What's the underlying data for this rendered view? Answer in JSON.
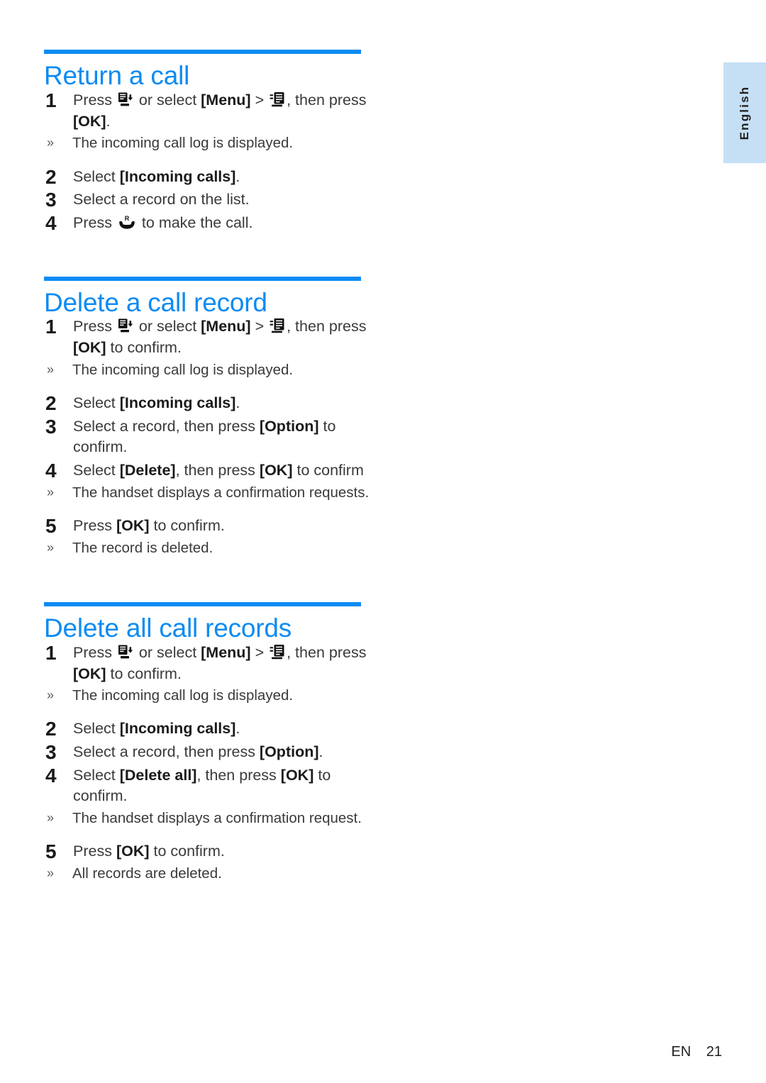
{
  "language_tab": {
    "label": "English"
  },
  "footer": {
    "locale": "EN",
    "page": "21"
  },
  "colors": {
    "accent": "#0d8bf2",
    "tab_background": "#c5e0f5",
    "body_text": "#3a3a3c"
  },
  "icons": {
    "call_log_key": "call-log-key-icon",
    "call_log_menu": "call-log-menu-icon",
    "talk_key": "talk-key-icon"
  },
  "sections": [
    {
      "id": "return-a-call",
      "heading": "Return a call",
      "steps": [
        {
          "number": "1",
          "parts": [
            {
              "t": "Press "
            },
            {
              "icon": "call_log_key"
            },
            {
              "t": " or select "
            },
            {
              "t": "[Menu]",
              "b": true
            },
            {
              "t": " > "
            },
            {
              "icon": "call_log_menu"
            },
            {
              "t": ", then press "
            },
            {
              "t": "[OK]",
              "b": true
            },
            {
              "t": "."
            }
          ],
          "note": "The incoming call log is displayed."
        },
        {
          "number": "2",
          "parts": [
            {
              "t": "Select "
            },
            {
              "t": "[Incoming calls]",
              "b": true
            },
            {
              "t": "."
            }
          ]
        },
        {
          "number": "3",
          "parts": [
            {
              "t": "Select a record on the list."
            }
          ]
        },
        {
          "number": "4",
          "parts": [
            {
              "t": "Press "
            },
            {
              "icon": "talk_key"
            },
            {
              "t": " to make the call."
            }
          ]
        }
      ]
    },
    {
      "id": "delete-a-call-record",
      "heading": "Delete a call record",
      "steps": [
        {
          "number": "1",
          "parts": [
            {
              "t": "Press "
            },
            {
              "icon": "call_log_key"
            },
            {
              "t": " or select "
            },
            {
              "t": "[Menu]",
              "b": true
            },
            {
              "t": " > "
            },
            {
              "icon": "call_log_menu"
            },
            {
              "t": ", then press "
            },
            {
              "t": "[OK]",
              "b": true
            },
            {
              "t": " to confirm."
            }
          ],
          "note": "The incoming call log is displayed."
        },
        {
          "number": "2",
          "parts": [
            {
              "t": "Select "
            },
            {
              "t": "[Incoming calls]",
              "b": true
            },
            {
              "t": "."
            }
          ]
        },
        {
          "number": "3",
          "parts": [
            {
              "t": "Select a record, then press "
            },
            {
              "t": "[Option]",
              "b": true
            },
            {
              "t": " to confirm."
            }
          ]
        },
        {
          "number": "4",
          "parts": [
            {
              "t": "Select "
            },
            {
              "t": "[Delete]",
              "b": true
            },
            {
              "t": ", then press "
            },
            {
              "t": "[OK]",
              "b": true
            },
            {
              "t": " to confirm"
            }
          ],
          "note": "The handset displays a confirmation requests."
        },
        {
          "number": "5",
          "parts": [
            {
              "t": "Press "
            },
            {
              "t": "[OK]",
              "b": true
            },
            {
              "t": " to confirm."
            }
          ],
          "note": "The record is deleted."
        }
      ]
    },
    {
      "id": "delete-all-call-records",
      "heading": "Delete all call records",
      "steps": [
        {
          "number": "1",
          "parts": [
            {
              "t": "Press "
            },
            {
              "icon": "call_log_key"
            },
            {
              "t": " or select "
            },
            {
              "t": "[Menu]",
              "b": true
            },
            {
              "t": " > "
            },
            {
              "icon": "call_log_menu"
            },
            {
              "t": ", then press "
            },
            {
              "t": "[OK]",
              "b": true
            },
            {
              "t": " to confirm."
            }
          ],
          "note": "The incoming call log is displayed."
        },
        {
          "number": "2",
          "parts": [
            {
              "t": "Select "
            },
            {
              "t": "[Incoming calls]",
              "b": true
            },
            {
              "t": "."
            }
          ]
        },
        {
          "number": "3",
          "parts": [
            {
              "t": "Select a record, then press "
            },
            {
              "t": "[Option]",
              "b": true
            },
            {
              "t": "."
            }
          ]
        },
        {
          "number": "4",
          "parts": [
            {
              "t": "Select "
            },
            {
              "t": "[Delete all]",
              "b": true
            },
            {
              "t": ", then press "
            },
            {
              "t": "[OK]",
              "b": true
            },
            {
              "t": " to confirm."
            }
          ],
          "note": "The handset displays a confirmation request."
        },
        {
          "number": "5",
          "parts": [
            {
              "t": "Press "
            },
            {
              "t": "[OK]",
              "b": true
            },
            {
              "t": " to confirm."
            }
          ],
          "note": "All records are deleted."
        }
      ]
    }
  ]
}
